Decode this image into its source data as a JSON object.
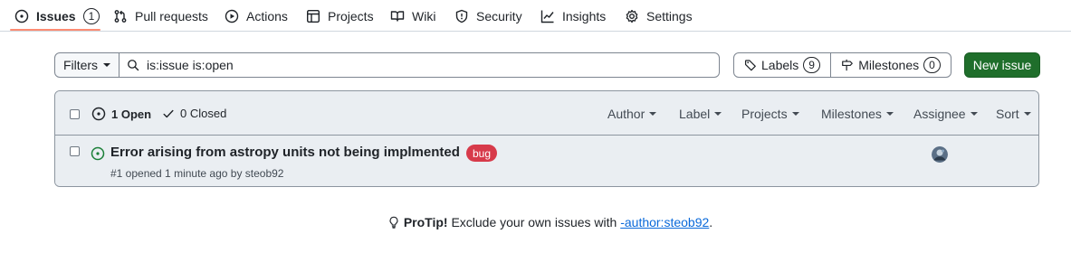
{
  "nav": {
    "tabs": [
      {
        "label": "Issues",
        "icon": "issue-opened-icon",
        "counter": "1",
        "selected": true
      },
      {
        "label": "Pull requests",
        "icon": "git-pull-request-icon"
      },
      {
        "label": "Actions",
        "icon": "play-icon"
      },
      {
        "label": "Projects",
        "icon": "table-icon"
      },
      {
        "label": "Wiki",
        "icon": "book-icon"
      },
      {
        "label": "Security",
        "icon": "shield-icon"
      },
      {
        "label": "Insights",
        "icon": "graph-icon"
      },
      {
        "label": "Settings",
        "icon": "gear-icon"
      }
    ]
  },
  "toolbar": {
    "filters_label": "Filters",
    "search_value": "is:issue is:open",
    "labels_label": "Labels",
    "labels_count": "9",
    "milestones_label": "Milestones",
    "milestones_count": "0",
    "new_issue_label": "New issue"
  },
  "list_header": {
    "open_label": "1 Open",
    "closed_label": "0 Closed",
    "filters": [
      "Author",
      "Label",
      "Projects",
      "Milestones",
      "Assignee",
      "Sort"
    ]
  },
  "issues": [
    {
      "title": "Error arising from astropy units not being implmented",
      "label": "bug",
      "meta": "#1 opened 1 minute ago by steob92"
    }
  ],
  "protip": {
    "prefix": "ProTip!",
    "text": " Exclude your own issues with ",
    "link": "-author:steob92",
    "suffix": "."
  },
  "colors": {
    "accent_underline": "#fd8c73",
    "new_issue_bg": "#1f6e2b",
    "bug_label": "#d73a4a",
    "open_icon": "#1a7f37",
    "link": "#0969da"
  }
}
